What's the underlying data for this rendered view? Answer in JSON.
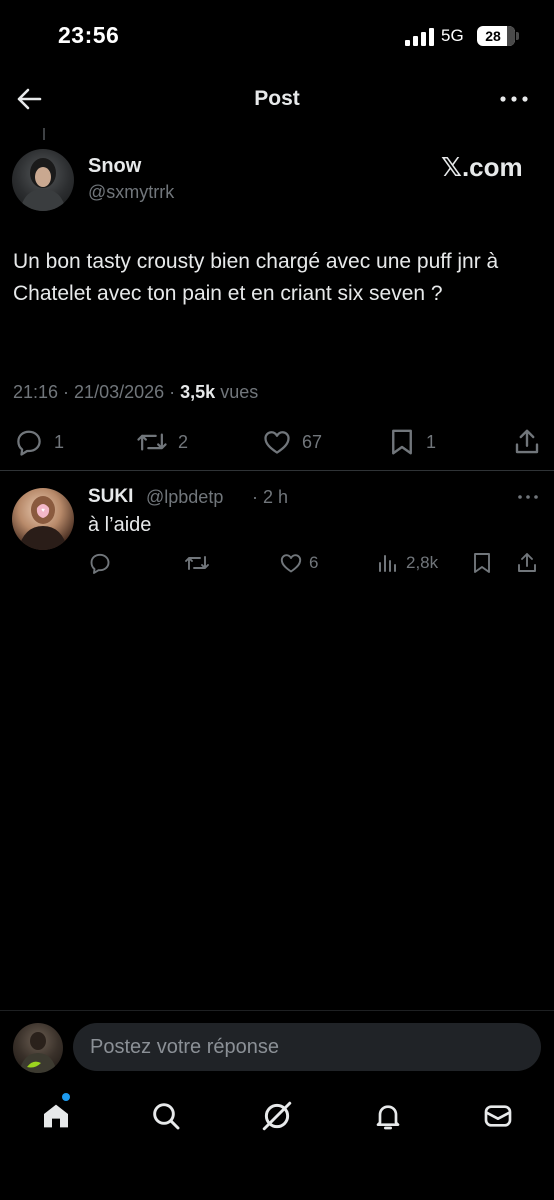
{
  "status_bar": {
    "time": "23:56",
    "network": "5G",
    "battery": "28"
  },
  "header": {
    "title": "Post",
    "back_icon": "arrow-left-icon",
    "more_icon": "more-horizontal-icon"
  },
  "post": {
    "author_name": "Snow",
    "author_handle": "@sxmytrrk",
    "source_badge": "𝕏.com",
    "text": "Un bon tasty crousty bien chargé avec une puff jnr à Chatelet avec ton pain et en criant six seven ?",
    "time": "21:16",
    "date": "21/03/2026",
    "meta_separator": " · ",
    "views_count": "3,5k",
    "views_label": "vues",
    "stats": {
      "replies": "1",
      "reposts": "2",
      "likes": "67",
      "bookmarks": "1"
    }
  },
  "reply": {
    "author_name": "SUKI",
    "author_handle": "@lpbdetp",
    "time": "· 2 h",
    "text": "à l’aide",
    "stats": {
      "likes": "6",
      "views": "2,8k"
    }
  },
  "compose": {
    "placeholder": "Postez votre réponse"
  },
  "nav": {
    "items": [
      "home-icon",
      "search-icon",
      "grok-icon",
      "notifications-icon",
      "messages-icon"
    ],
    "home_has_notification": true
  },
  "colors": {
    "background": "#000000",
    "text": "#e7e9ea",
    "muted": "#71767b",
    "divider": "#2f3336",
    "accent": "#1d9bf0",
    "input_bg": "#202327"
  }
}
